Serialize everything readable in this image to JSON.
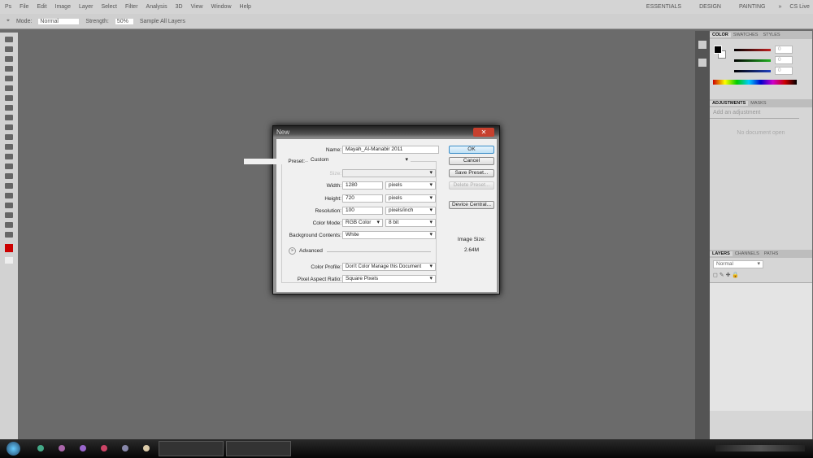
{
  "menu": [
    "Ps",
    "File",
    "Edit",
    "Image",
    "Layer",
    "Select",
    "Filter",
    "Analysis",
    "3D",
    "View",
    "Window",
    "Help"
  ],
  "workspaces": [
    "ESSENTIALS",
    "DESIGN",
    "PAINTING",
    "»",
    "CS Live"
  ],
  "options": {
    "mode_label": "Mode:",
    "mode_value": "Normal",
    "strength_label": "Strength:",
    "strength_value": "50%",
    "sample_all": "Sample All Layers"
  },
  "color_panel": {
    "tabs": [
      "COLOR",
      "SWATCHES",
      "STYLES"
    ],
    "r": "0",
    "g": "0",
    "b": "0",
    "colors": {
      "r": "#c02020",
      "g": "#20b020",
      "b": "#2040c0"
    }
  },
  "adjustments_panel": {
    "tabs": [
      "ADJUSTMENTS",
      "MASKS"
    ],
    "hint": "Add an adjustment",
    "empty": "No document open"
  },
  "layers_panel": {
    "tabs": [
      "LAYERS",
      "CHANNELS",
      "PATHS"
    ],
    "blend": "Normal"
  },
  "dialog": {
    "title": "New",
    "close": "✕",
    "name_label": "Name:",
    "name_value": "Mayah_Al-Manabir 2011",
    "preset_label": "Preset:",
    "preset_value": "Custom",
    "size_label": "Size:",
    "width_label": "Width:",
    "width_value": "1280",
    "width_unit": "pixels",
    "height_label": "Height:",
    "height_value": "720",
    "height_unit": "pixels",
    "res_label": "Resolution:",
    "res_value": "100",
    "res_unit": "pixels/inch",
    "mode_label": "Color Mode:",
    "mode_value": "RGB Color",
    "depth_value": "8 bit",
    "bg_label": "Background Contents:",
    "bg_value": "White",
    "advanced": "Advanced",
    "profile_label": "Color Profile:",
    "profile_value": "Don't Color Manage this Document",
    "par_label": "Pixel Aspect Ratio:",
    "par_value": "Square Pixels",
    "ok": "OK",
    "cancel": "Cancel",
    "save_preset": "Save Preset...",
    "delete_preset": "Delete Preset...",
    "device_central": "Device Central...",
    "image_size_label": "Image Size:",
    "image_size_value": "2.64M"
  }
}
